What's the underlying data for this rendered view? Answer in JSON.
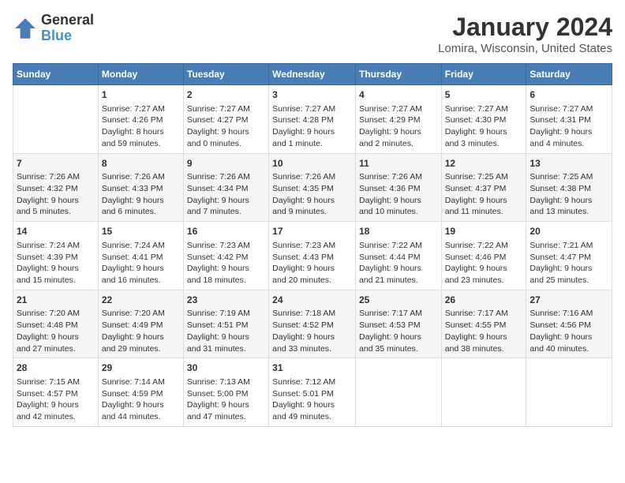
{
  "logo": {
    "line1": "General",
    "line2": "Blue"
  },
  "title": "January 2024",
  "subtitle": "Lomira, Wisconsin, United States",
  "headers": [
    "Sunday",
    "Monday",
    "Tuesday",
    "Wednesday",
    "Thursday",
    "Friday",
    "Saturday"
  ],
  "weeks": [
    [
      {
        "day": "",
        "content": ""
      },
      {
        "day": "1",
        "content": "Sunrise: 7:27 AM\nSunset: 4:26 PM\nDaylight: 8 hours\nand 59 minutes."
      },
      {
        "day": "2",
        "content": "Sunrise: 7:27 AM\nSunset: 4:27 PM\nDaylight: 9 hours\nand 0 minutes."
      },
      {
        "day": "3",
        "content": "Sunrise: 7:27 AM\nSunset: 4:28 PM\nDaylight: 9 hours\nand 1 minute."
      },
      {
        "day": "4",
        "content": "Sunrise: 7:27 AM\nSunset: 4:29 PM\nDaylight: 9 hours\nand 2 minutes."
      },
      {
        "day": "5",
        "content": "Sunrise: 7:27 AM\nSunset: 4:30 PM\nDaylight: 9 hours\nand 3 minutes."
      },
      {
        "day": "6",
        "content": "Sunrise: 7:27 AM\nSunset: 4:31 PM\nDaylight: 9 hours\nand 4 minutes."
      }
    ],
    [
      {
        "day": "7",
        "content": "Sunrise: 7:26 AM\nSunset: 4:32 PM\nDaylight: 9 hours\nand 5 minutes."
      },
      {
        "day": "8",
        "content": "Sunrise: 7:26 AM\nSunset: 4:33 PM\nDaylight: 9 hours\nand 6 minutes."
      },
      {
        "day": "9",
        "content": "Sunrise: 7:26 AM\nSunset: 4:34 PM\nDaylight: 9 hours\nand 7 minutes."
      },
      {
        "day": "10",
        "content": "Sunrise: 7:26 AM\nSunset: 4:35 PM\nDaylight: 9 hours\nand 9 minutes."
      },
      {
        "day": "11",
        "content": "Sunrise: 7:26 AM\nSunset: 4:36 PM\nDaylight: 9 hours\nand 10 minutes."
      },
      {
        "day": "12",
        "content": "Sunrise: 7:25 AM\nSunset: 4:37 PM\nDaylight: 9 hours\nand 11 minutes."
      },
      {
        "day": "13",
        "content": "Sunrise: 7:25 AM\nSunset: 4:38 PM\nDaylight: 9 hours\nand 13 minutes."
      }
    ],
    [
      {
        "day": "14",
        "content": "Sunrise: 7:24 AM\nSunset: 4:39 PM\nDaylight: 9 hours\nand 15 minutes."
      },
      {
        "day": "15",
        "content": "Sunrise: 7:24 AM\nSunset: 4:41 PM\nDaylight: 9 hours\nand 16 minutes."
      },
      {
        "day": "16",
        "content": "Sunrise: 7:23 AM\nSunset: 4:42 PM\nDaylight: 9 hours\nand 18 minutes."
      },
      {
        "day": "17",
        "content": "Sunrise: 7:23 AM\nSunset: 4:43 PM\nDaylight: 9 hours\nand 20 minutes."
      },
      {
        "day": "18",
        "content": "Sunrise: 7:22 AM\nSunset: 4:44 PM\nDaylight: 9 hours\nand 21 minutes."
      },
      {
        "day": "19",
        "content": "Sunrise: 7:22 AM\nSunset: 4:46 PM\nDaylight: 9 hours\nand 23 minutes."
      },
      {
        "day": "20",
        "content": "Sunrise: 7:21 AM\nSunset: 4:47 PM\nDaylight: 9 hours\nand 25 minutes."
      }
    ],
    [
      {
        "day": "21",
        "content": "Sunrise: 7:20 AM\nSunset: 4:48 PM\nDaylight: 9 hours\nand 27 minutes."
      },
      {
        "day": "22",
        "content": "Sunrise: 7:20 AM\nSunset: 4:49 PM\nDaylight: 9 hours\nand 29 minutes."
      },
      {
        "day": "23",
        "content": "Sunrise: 7:19 AM\nSunset: 4:51 PM\nDaylight: 9 hours\nand 31 minutes."
      },
      {
        "day": "24",
        "content": "Sunrise: 7:18 AM\nSunset: 4:52 PM\nDaylight: 9 hours\nand 33 minutes."
      },
      {
        "day": "25",
        "content": "Sunrise: 7:17 AM\nSunset: 4:53 PM\nDaylight: 9 hours\nand 35 minutes."
      },
      {
        "day": "26",
        "content": "Sunrise: 7:17 AM\nSunset: 4:55 PM\nDaylight: 9 hours\nand 38 minutes."
      },
      {
        "day": "27",
        "content": "Sunrise: 7:16 AM\nSunset: 4:56 PM\nDaylight: 9 hours\nand 40 minutes."
      }
    ],
    [
      {
        "day": "28",
        "content": "Sunrise: 7:15 AM\nSunset: 4:57 PM\nDaylight: 9 hours\nand 42 minutes."
      },
      {
        "day": "29",
        "content": "Sunrise: 7:14 AM\nSunset: 4:59 PM\nDaylight: 9 hours\nand 44 minutes."
      },
      {
        "day": "30",
        "content": "Sunrise: 7:13 AM\nSunset: 5:00 PM\nDaylight: 9 hours\nand 47 minutes."
      },
      {
        "day": "31",
        "content": "Sunrise: 7:12 AM\nSunset: 5:01 PM\nDaylight: 9 hours\nand 49 minutes."
      },
      {
        "day": "",
        "content": ""
      },
      {
        "day": "",
        "content": ""
      },
      {
        "day": "",
        "content": ""
      }
    ]
  ]
}
